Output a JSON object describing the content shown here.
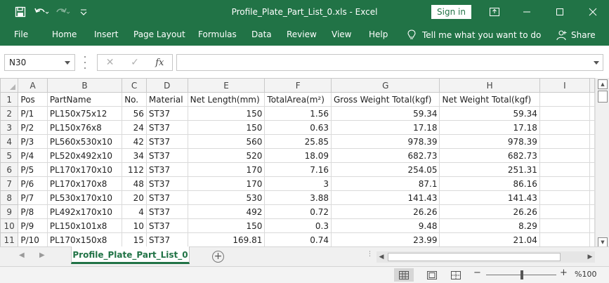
{
  "window": {
    "title": "Profile_Plate_Part_List_0.xls  -  Excel",
    "sign_in": "Sign in"
  },
  "ribbon": {
    "tabs": [
      "File",
      "Home",
      "Insert",
      "Page Layout",
      "Formulas",
      "Data",
      "Review",
      "View",
      "Help"
    ],
    "tell_me": "Tell me what you want to do",
    "share": "Share"
  },
  "formula_bar": {
    "name_box": "N30",
    "fx": "fx",
    "value": ""
  },
  "sheet": {
    "column_letters": [
      "A",
      "B",
      "C",
      "D",
      "E",
      "F",
      "G",
      "H",
      "I"
    ],
    "row_numbers": [
      "1",
      "2",
      "3",
      "4",
      "5",
      "6",
      "7",
      "8",
      "9",
      "10",
      "11"
    ],
    "header": [
      "Pos",
      "PartName",
      "No.",
      "Material",
      "Net Length(mm)",
      "TotalArea(m²)",
      "Gross Weight Total(kgf)",
      "Net Weight Total(kgf)",
      ""
    ],
    "rows": [
      [
        "P/1",
        "PL150x75x12",
        "56",
        "ST37",
        "150",
        "1.56",
        "59.34",
        "59.34",
        ""
      ],
      [
        "P/2",
        "PL150x76x8",
        "24",
        "ST37",
        "150",
        "0.63",
        "17.18",
        "17.18",
        ""
      ],
      [
        "P/3",
        "PL560x530x10",
        "42",
        "ST37",
        "560",
        "25.85",
        "978.39",
        "978.39",
        ""
      ],
      [
        "P/4",
        "PL520x492x10",
        "34",
        "ST37",
        "520",
        "18.09",
        "682.73",
        "682.73",
        ""
      ],
      [
        "P/5",
        "PL170x170x10",
        "112",
        "ST37",
        "170",
        "7.16",
        "254.05",
        "251.31",
        ""
      ],
      [
        "P/6",
        "PL170x170x8",
        "48",
        "ST37",
        "170",
        "3",
        "87.1",
        "86.16",
        ""
      ],
      [
        "P/7",
        "PL530x170x10",
        "20",
        "ST37",
        "530",
        "3.88",
        "141.43",
        "141.43",
        ""
      ],
      [
        "P/8",
        "PL492x170x10",
        "4",
        "ST37",
        "492",
        "0.72",
        "26.26",
        "26.26",
        ""
      ],
      [
        "P/9",
        "PL150x101x8",
        "10",
        "ST37",
        "150",
        "0.3",
        "9.48",
        "8.29",
        ""
      ],
      [
        "P/10",
        "PL170x150x8",
        "15",
        "ST37",
        "169.81",
        "0.74",
        "23.99",
        "21.04",
        ""
      ]
    ],
    "tab_name": "Profile_Plate_Part_List_0"
  },
  "status": {
    "zoom": "%100"
  },
  "colors": {
    "brand": "#217346"
  }
}
